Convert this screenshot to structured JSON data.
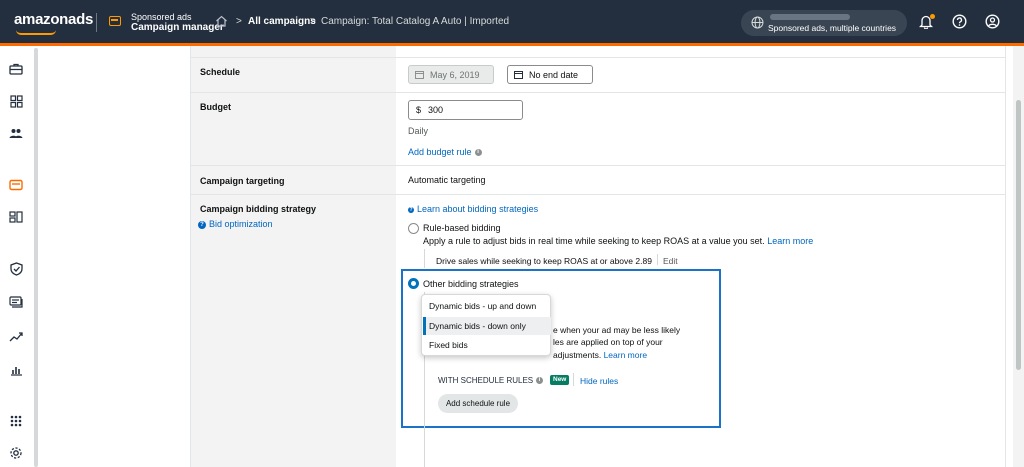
{
  "header": {
    "logo": "amazonads",
    "product_line1": "Sponsored ads",
    "product_line2": "Campaign manager",
    "breadcrumb": [
      "All campaigns",
      "Campaign: Total Catalog A Auto | Imported"
    ],
    "account_text": "Sponsored ads, multiple countries"
  },
  "schedule": {
    "label": "Schedule",
    "start_date": "May 6, 2019",
    "end_date": "No end date"
  },
  "budget": {
    "label": "Budget",
    "currency": "$",
    "value": "300",
    "period": "Daily",
    "rule_link": "Add budget rule"
  },
  "targeting": {
    "label": "Campaign targeting",
    "value": "Automatic targeting"
  },
  "bidding": {
    "label": "Campaign bidding strategy",
    "help_link": "Bid optimization",
    "learn_link": "Learn about bidding strategies",
    "rule_based_title": "Rule-based bidding",
    "rule_based_desc": "Apply a rule to adjust bids in real time while seeking to keep ROAS at a value you set.",
    "learn_more": "Learn more",
    "rule_summary": "Drive sales while seeking to keep ROAS at or above 2.89",
    "edit": "Edit",
    "other_title": "Other bidding strategies",
    "dropdown_options": [
      "Dynamic bids - up and down",
      "Dynamic bids - down only",
      "Fixed bids"
    ],
    "dropdown_selected": "Dynamic bids - down only",
    "desc_line1": "e when your ad may be less likely",
    "desc_line2": "les are applied on top of your",
    "desc_line3": "adjustments.",
    "desc_learn_more": "Learn more",
    "schedule_rules_label": "WITH SCHEDULE RULES",
    "new_badge": "New",
    "hide_rules": "Hide rules",
    "add_schedule_rule": "Add schedule rule"
  },
  "colors": {
    "topbar": "#232f3e",
    "accent": "#ff9900",
    "link": "#0066c0",
    "highlight": "#1a73c9"
  }
}
